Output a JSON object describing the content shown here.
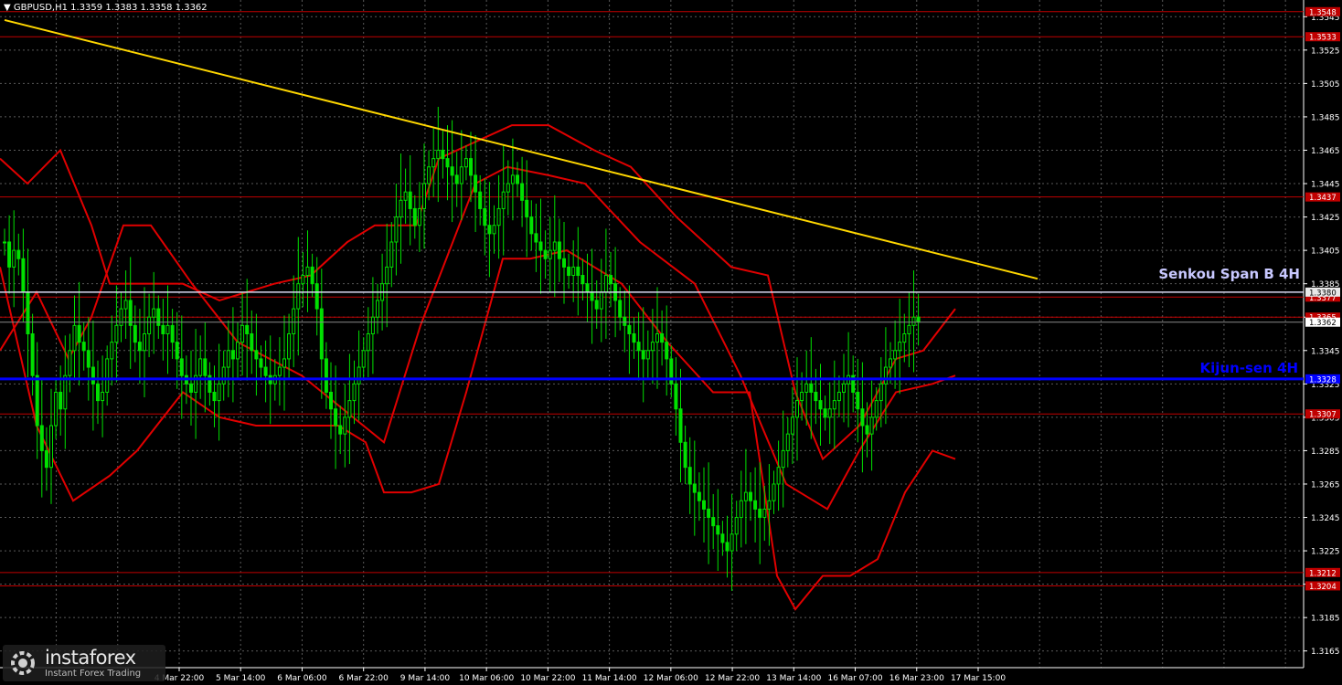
{
  "header": {
    "symbol": "GBPUSD,H1",
    "ohlc": "1.3359 1.3383 1.3358 1.3362"
  },
  "logo": {
    "name": "instaforex",
    "tagline": "Instant Forex Trading"
  },
  "colors": {
    "background": "#000000",
    "grid": "#5a5a5a",
    "candles": "#00e000",
    "resistance_lines": "#c00000",
    "ichimoku": "#e00000",
    "kijun_h4": "#0000ff",
    "trendline": "#ffd700",
    "senkou_label": "#c8c8ff",
    "axis_text": "#ffffff",
    "price_tag": "#c00000"
  },
  "chart_data": {
    "type": "candlestick",
    "instrument": "GBPUSD",
    "timeframe": "H1",
    "ylim": [
      1.3155,
      1.3555
    ],
    "grid": true,
    "y_ticks": [
      1.3165,
      1.3185,
      1.3205,
      1.3225,
      1.3245,
      1.3265,
      1.3285,
      1.3305,
      1.3325,
      1.3345,
      1.3365,
      1.3385,
      1.3405,
      1.3425,
      1.3445,
      1.3465,
      1.3485,
      1.3505,
      1.3525,
      1.3545
    ],
    "x_ticks": [
      "4 Mar 22:00",
      "5 Mar 14:00",
      "6 Mar 06:00",
      "6 Mar 22:00",
      "9 Mar 14:00",
      "10 Mar 06:00",
      "10 Mar 22:00",
      "11 Mar 14:00",
      "12 Mar 06:00",
      "12 Mar 22:00",
      "13 Mar 14:00",
      "16 Mar 07:00",
      "16 Mar 23:00",
      "17 Mar 15:00"
    ],
    "horizontal_levels": [
      {
        "price": 1.3548,
        "label": "1.3548",
        "color": "#c00000"
      },
      {
        "price": 1.3533,
        "label": "1.3533",
        "color": "#c00000"
      },
      {
        "price": 1.3437,
        "label": "1.3437",
        "color": "#c00000"
      },
      {
        "price": 1.3377,
        "label": "1.3377",
        "color": "#c00000"
      },
      {
        "price": 1.3365,
        "label": "1.3365",
        "color": "#c00000"
      },
      {
        "price": 1.3307,
        "label": "1.3307",
        "color": "#c00000"
      },
      {
        "price": 1.3212,
        "label": "1.3212",
        "color": "#c00000"
      },
      {
        "price": 1.3204,
        "label": "1.3204",
        "color": "#c00000"
      }
    ],
    "senkou_span_b_4h": {
      "price": 1.338,
      "label": "1.3380",
      "text": "Senkou Span B 4H"
    },
    "kijun_sen_4h": {
      "price": 1.3328,
      "label": "1.3328",
      "text": "Kijun-sen 4H"
    },
    "current_price": {
      "price": 1.3362,
      "label": "1.3362"
    },
    "trendline": {
      "start": {
        "i": 0,
        "price": 1.3543
      },
      "end": {
        "i": 199,
        "price": 1.3388
      }
    },
    "closes": [
      1.341,
      1.3395,
      1.3405,
      1.34,
      1.338,
      1.3355,
      1.333,
      1.33,
      1.3285,
      1.3275,
      1.33,
      1.332,
      1.331,
      1.333,
      1.3345,
      1.336,
      1.335,
      1.3345,
      1.3335,
      1.3325,
      1.3315,
      1.332,
      1.334,
      1.335,
      1.336,
      1.337,
      1.3375,
      1.336,
      1.335,
      1.3345,
      1.3355,
      1.3365,
      1.337,
      1.336,
      1.3355,
      1.336,
      1.335,
      1.334,
      1.333,
      1.3325,
      1.332,
      1.333,
      1.334,
      1.333,
      1.332,
      1.3315,
      1.3325,
      1.3335,
      1.3345,
      1.334,
      1.335,
      1.336,
      1.3355,
      1.3345,
      1.334,
      1.3335,
      1.333,
      1.3325,
      1.333,
      1.3335,
      1.334,
      1.3355,
      1.337,
      1.3385,
      1.339,
      1.3395,
      1.3385,
      1.337,
      1.334,
      1.332,
      1.331,
      1.33,
      1.3295,
      1.3305,
      1.3315,
      1.3325,
      1.3335,
      1.3345,
      1.3355,
      1.3365,
      1.3375,
      1.3385,
      1.3395,
      1.341,
      1.3425,
      1.3435,
      1.344,
      1.343,
      1.342,
      1.343,
      1.3445,
      1.3455,
      1.346,
      1.3465,
      1.346,
      1.3455,
      1.345,
      1.3445,
      1.3455,
      1.346,
      1.345,
      1.344,
      1.343,
      1.342,
      1.3415,
      1.342,
      1.343,
      1.344,
      1.3445,
      1.345,
      1.3445,
      1.3435,
      1.3425,
      1.3415,
      1.341,
      1.3405,
      1.34,
      1.3405,
      1.341,
      1.34,
      1.3395,
      1.339,
      1.3395,
      1.339,
      1.3385,
      1.338,
      1.3375,
      1.337,
      1.338,
      1.339,
      1.3385,
      1.3375,
      1.3365,
      1.336,
      1.3355,
      1.335,
      1.3345,
      1.334,
      1.3345,
      1.335,
      1.3355,
      1.335,
      1.334,
      1.3325,
      1.331,
      1.329,
      1.3275,
      1.3265,
      1.326,
      1.3255,
      1.325,
      1.3245,
      1.324,
      1.3235,
      1.323,
      1.3225,
      1.3235,
      1.3245,
      1.3255,
      1.326,
      1.3255,
      1.325,
      1.3245,
      1.325,
      1.3255,
      1.3265,
      1.3275,
      1.3285,
      1.3295,
      1.3305,
      1.3315,
      1.332,
      1.3325,
      1.332,
      1.3315,
      1.331,
      1.3305,
      1.331,
      1.3315,
      1.332,
      1.3325,
      1.333,
      1.332,
      1.331,
      1.33,
      1.3295,
      1.3305,
      1.3315,
      1.3325,
      1.3335,
      1.334,
      1.3345,
      1.335,
      1.3355,
      1.336,
      1.3365,
      1.3362
    ],
    "red_lines": [
      [
        [
          0,
          1.3345
        ],
        [
          40,
          1.338
        ],
        [
          75,
          1.334
        ],
        [
          100,
          1.3365
        ],
        [
          135,
          1.342
        ],
        [
          165,
          1.342
        ],
        [
          210,
          1.3385
        ],
        [
          260,
          1.335
        ],
        [
          330,
          1.333
        ],
        [
          420,
          1.329
        ],
        [
          460,
          1.336
        ],
        [
          520,
          1.3445
        ],
        [
          555,
          1.3455
        ],
        [
          600,
          1.345
        ],
        [
          640,
          1.3445
        ],
        [
          700,
          1.341
        ],
        [
          760,
          1.3385
        ],
        [
          810,
          1.333
        ],
        [
          860,
          1.3265
        ],
        [
          905,
          1.325
        ],
        [
          940,
          1.3285
        ],
        [
          980,
          1.332
        ],
        [
          1020,
          1.3325
        ],
        [
          1045,
          1.333
        ]
      ],
      [
        [
          0,
          1.346
        ],
        [
          30,
          1.3445
        ],
        [
          66,
          1.3465
        ],
        [
          100,
          1.342
        ],
        [
          120,
          1.3385
        ],
        [
          150,
          1.3385
        ],
        [
          200,
          1.3385
        ],
        [
          240,
          1.3375
        ],
        [
          300,
          1.3385
        ],
        [
          340,
          1.339
        ],
        [
          380,
          1.341
        ],
        [
          410,
          1.342
        ],
        [
          455,
          1.342
        ],
        [
          480,
          1.346
        ],
        [
          520,
          1.347
        ],
        [
          560,
          1.348
        ],
        [
          600,
          1.348
        ],
        [
          650,
          1.3465
        ],
        [
          690,
          1.3455
        ],
        [
          740,
          1.3425
        ],
        [
          800,
          1.3395
        ],
        [
          840,
          1.339
        ],
        [
          870,
          1.332
        ],
        [
          900,
          1.328
        ],
        [
          940,
          1.33
        ],
        [
          980,
          1.334
        ],
        [
          1010,
          1.3345
        ],
        [
          1045,
          1.337
        ]
      ],
      [
        [
          0,
          1.3395
        ],
        [
          40,
          1.33
        ],
        [
          80,
          1.3255
        ],
        [
          120,
          1.327
        ],
        [
          150,
          1.3285
        ],
        [
          200,
          1.332
        ],
        [
          240,
          1.3305
        ],
        [
          280,
          1.33
        ],
        [
          330,
          1.33
        ],
        [
          370,
          1.33
        ],
        [
          400,
          1.329
        ],
        [
          420,
          1.326
        ],
        [
          450,
          1.326
        ],
        [
          480,
          1.3265
        ],
        [
          510,
          1.332
        ],
        [
          550,
          1.34
        ],
        [
          580,
          1.34
        ],
        [
          620,
          1.3405
        ],
        [
          680,
          1.3385
        ],
        [
          730,
          1.335
        ],
        [
          780,
          1.332
        ],
        [
          820,
          1.332
        ],
        [
          850,
          1.321
        ],
        [
          870,
          1.319
        ],
        [
          900,
          1.321
        ],
        [
          930,
          1.321
        ],
        [
          960,
          1.322
        ],
        [
          990,
          1.326
        ],
        [
          1020,
          1.3285
        ],
        [
          1045,
          1.328
        ]
      ]
    ]
  }
}
